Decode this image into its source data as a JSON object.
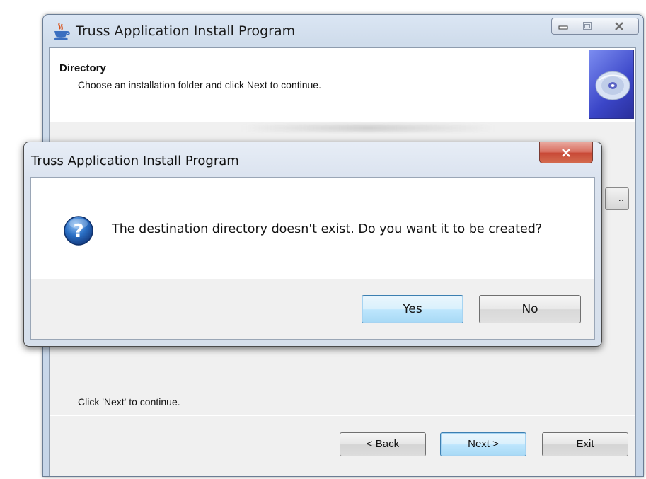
{
  "main_window": {
    "title": "Truss Application Install Program",
    "header": {
      "title": "Directory",
      "subtitle": "Choose an installation folder and click Next to continue."
    },
    "footer_text": "Click 'Next' to continue.",
    "browse_stub_label": "..",
    "buttons": {
      "back": "< Back",
      "next": "Next >",
      "exit": "Exit"
    }
  },
  "dialog": {
    "title": "Truss Application Install Program",
    "message": "The destination directory doesn't exist. Do you want it to be created?",
    "buttons": {
      "yes": "Yes",
      "no": "No"
    }
  },
  "icons": {
    "app": "java-cup-icon",
    "header": "cd-disc-icon",
    "dialog": "question-icon"
  },
  "colors": {
    "default_button_border": "#3c7fb1",
    "close_button": "#c84836",
    "cd_badge": "#3b46c8",
    "question_icon": "#1f5fae"
  }
}
